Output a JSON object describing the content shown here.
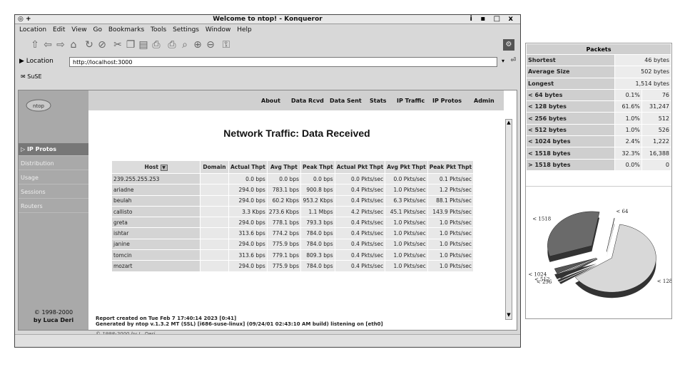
{
  "window": {
    "title": "Welcome to ntop! - Konqueror",
    "controls": "i ▪ □ x"
  },
  "menu": [
    "Location",
    "Edit",
    "View",
    "Go",
    "Bookmarks",
    "Tools",
    "Settings",
    "Window",
    "Help"
  ],
  "toolbar_icons": [
    "up-icon",
    "back-icon",
    "forward-icon",
    "home-icon",
    "reload-icon",
    "stop-icon",
    "cut-icon",
    "copy-icon",
    "paste-icon",
    "print-icon",
    "print-frame-icon",
    "find-icon",
    "zoom-in-icon",
    "zoom-out-icon",
    "security-icon"
  ],
  "location": {
    "label": "Location",
    "url": "http://localhost:3000"
  },
  "bookmarks": {
    "item": "SuSE"
  },
  "nav": [
    "About",
    "Data Rcvd",
    "Data Sent",
    "Stats",
    "IP Traffic",
    "IP Protos",
    "Admin"
  ],
  "sidebar": {
    "items": [
      {
        "label": "IP Protos",
        "active": true
      },
      {
        "label": "Distribution",
        "active": false
      },
      {
        "label": "Usage",
        "active": false
      },
      {
        "label": "Sessions",
        "active": false
      },
      {
        "label": "Routers",
        "active": false
      }
    ],
    "copyright_line1": "© 1998-2000",
    "copyright_line2": "by Luca Deri"
  },
  "heading": "Network Traffic: Data Received",
  "table": {
    "headers": [
      "Host",
      "Domain",
      "Actual Thpt",
      "Avg Thpt",
      "Peak Thpt",
      "Actual Pkt Thpt",
      "Avg Pkt Thpt",
      "Peak Pkt Thpt"
    ],
    "rows": [
      [
        "239.255.255.253",
        "",
        "0.0 bps",
        "0.0 bps",
        "0.0 bps",
        "0.0 Pkts/sec",
        "0.0 Pkts/sec",
        "0.1 Pkts/sec"
      ],
      [
        "ariadne",
        "",
        "294.0 bps",
        "783.1 bps",
        "900.8 bps",
        "0.4 Pkts/sec",
        "1.0 Pkts/sec",
        "1.2 Pkts/sec"
      ],
      [
        "beulah",
        "",
        "294.0 bps",
        "60.2 Kbps",
        "953.2 Kbps",
        "0.4 Pkts/sec",
        "6.3 Pkts/sec",
        "88.1 Pkts/sec"
      ],
      [
        "callisto",
        "",
        "3.3 Kbps",
        "273.6 Kbps",
        "1.1 Mbps",
        "4.2 Pkts/sec",
        "45.1 Pkts/sec",
        "143.9 Pkts/sec"
      ],
      [
        "greta",
        "",
        "294.0 bps",
        "778.1 bps",
        "793.3 bps",
        "0.4 Pkts/sec",
        "1.0 Pkts/sec",
        "1.0 Pkts/sec"
      ],
      [
        "ishtar",
        "",
        "313.6 bps",
        "774.2 bps",
        "784.0 bps",
        "0.4 Pkts/sec",
        "1.0 Pkts/sec",
        "1.0 Pkts/sec"
      ],
      [
        "janine",
        "",
        "294.0 bps",
        "775.9 bps",
        "784.0 bps",
        "0.4 Pkts/sec",
        "1.0 Pkts/sec",
        "1.0 Pkts/sec"
      ],
      [
        "tomcin",
        "",
        "313.6 bps",
        "779.1 bps",
        "809.3 bps",
        "0.4 Pkts/sec",
        "1.0 Pkts/sec",
        "1.0 Pkts/sec"
      ],
      [
        "mozart",
        "",
        "294.0 bps",
        "775.9 bps",
        "784.0 bps",
        "0.4 Pkts/sec",
        "1.0 Pkts/sec",
        "1.0 Pkts/sec"
      ]
    ]
  },
  "report": {
    "line1": "Report created on Tue Feb 7 17:40:14 2023 [0:41]",
    "line2": "Generated by ntop v.1.3.2 MT (SSL) [i686-suse-linux] (09/24/01 02:43:10 AM build) listening on [eth0]"
  },
  "footer": "© 1998-2000 by L. Deri",
  "packets": {
    "title": "Packets",
    "rows": [
      {
        "label": "Shortest",
        "pct": "",
        "value": "46 bytes"
      },
      {
        "label": "Average Size",
        "pct": "",
        "value": "502 bytes"
      },
      {
        "label": "Longest",
        "pct": "",
        "value": "1,514 bytes"
      },
      {
        "label": "< 64 bytes",
        "pct": "0.1%",
        "value": "76"
      },
      {
        "label": "< 128 bytes",
        "pct": "61.6%",
        "value": "31,247"
      },
      {
        "label": "< 256 bytes",
        "pct": "1.0%",
        "value": "512"
      },
      {
        "label": "< 512 bytes",
        "pct": "1.0%",
        "value": "526"
      },
      {
        "label": "< 1024 bytes",
        "pct": "2.4%",
        "value": "1,222"
      },
      {
        "label": "< 1518 bytes",
        "pct": "32.3%",
        "value": "16,388"
      },
      {
        "label": "> 1518 bytes",
        "pct": "0.0%",
        "value": "0"
      }
    ]
  },
  "chart_data": {
    "type": "pie",
    "categories": [
      "< 64",
      "< 128",
      "< 256",
      "< 512",
      "< 1024",
      "< 1518"
    ],
    "values": [
      0.1,
      61.6,
      1.0,
      1.0,
      2.4,
      32.3
    ]
  }
}
